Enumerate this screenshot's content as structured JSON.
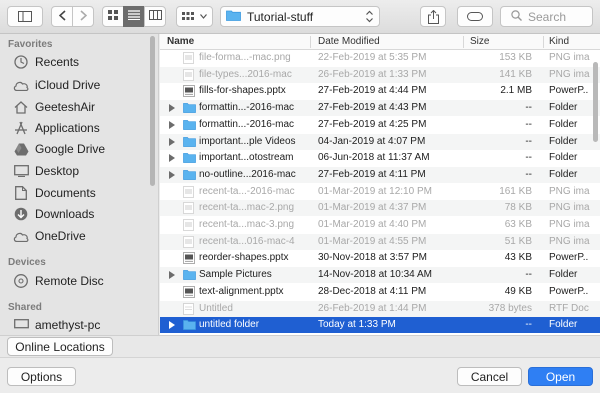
{
  "toolbar": {
    "location": "Tutorial-stuff",
    "search_placeholder": "Search"
  },
  "sidebar": {
    "favorites_header": "Favorites",
    "favorites": [
      {
        "label": "Recents",
        "icon": "clock-icon"
      },
      {
        "label": "iCloud Drive",
        "icon": "cloud-icon"
      },
      {
        "label": "GeeteshAir",
        "icon": "house-icon"
      },
      {
        "label": "Applications",
        "icon": "applications-icon"
      },
      {
        "label": "Google Drive",
        "icon": "google-drive-icon"
      },
      {
        "label": "Desktop",
        "icon": "desktop-icon"
      },
      {
        "label": "Documents",
        "icon": "document-icon"
      },
      {
        "label": "Downloads",
        "icon": "download-icon"
      },
      {
        "label": "OneDrive",
        "icon": "onedrive-cloud-icon"
      }
    ],
    "devices_header": "Devices",
    "devices": [
      {
        "label": "Remote Disc",
        "icon": "disc-icon"
      }
    ],
    "shared_header": "Shared",
    "shared": [
      {
        "label": "amethyst-pc",
        "icon": "network-computer-icon"
      }
    ]
  },
  "columns": {
    "name": "Name",
    "date": "Date Modified",
    "size": "Size",
    "kind": "Kind"
  },
  "files": [
    {
      "name": "file-forma...-mac.png",
      "date": "22-Feb-2019 at 5:35 PM",
      "size": "153 KB",
      "kind": "PNG ima",
      "type": "image",
      "dim": true,
      "folder": false
    },
    {
      "name": "file-types...2016-mac",
      "date": "26-Feb-2019 at 1:33 PM",
      "size": "141 KB",
      "kind": "PNG ima",
      "type": "image",
      "dim": true,
      "folder": false
    },
    {
      "name": "fills-for-shapes.pptx",
      "date": "27-Feb-2019 at 4:44 PM",
      "size": "2.1 MB",
      "kind": "PowerP..",
      "type": "pptx",
      "dim": false,
      "folder": false
    },
    {
      "name": "formattin...-2016-mac",
      "date": "27-Feb-2019 at 4:43 PM",
      "size": "--",
      "kind": "Folder",
      "type": "folder",
      "dim": false,
      "folder": true
    },
    {
      "name": "formattin...-2016-mac",
      "date": "27-Feb-2019 at 4:25 PM",
      "size": "--",
      "kind": "Folder",
      "type": "folder",
      "dim": false,
      "folder": true
    },
    {
      "name": "important...ple Videos",
      "date": "04-Jan-2019 at 4:07 PM",
      "size": "--",
      "kind": "Folder",
      "type": "folder",
      "dim": false,
      "folder": true
    },
    {
      "name": "important...otostream",
      "date": "06-Jun-2018 at 11:37 AM",
      "size": "--",
      "kind": "Folder",
      "type": "folder",
      "dim": false,
      "folder": true
    },
    {
      "name": "no-outline...2016-mac",
      "date": "27-Feb-2019 at 4:11 PM",
      "size": "--",
      "kind": "Folder",
      "type": "folder",
      "dim": false,
      "folder": true
    },
    {
      "name": "recent-ta...-2016-mac",
      "date": "01-Mar-2019 at 12:10 PM",
      "size": "161 KB",
      "kind": "PNG ima",
      "type": "image",
      "dim": true,
      "folder": false
    },
    {
      "name": "recent-ta...mac-2.png",
      "date": "01-Mar-2019 at 4:37 PM",
      "size": "78 KB",
      "kind": "PNG ima",
      "type": "image",
      "dim": true,
      "folder": false
    },
    {
      "name": "recent-ta...mac-3.png",
      "date": "01-Mar-2019 at 4:40 PM",
      "size": "63 KB",
      "kind": "PNG ima",
      "type": "image",
      "dim": true,
      "folder": false
    },
    {
      "name": "recent-ta...016-mac-4",
      "date": "01-Mar-2019 at 4:55 PM",
      "size": "51 KB",
      "kind": "PNG ima",
      "type": "image",
      "dim": true,
      "folder": false
    },
    {
      "name": "reorder-shapes.pptx",
      "date": "30-Nov-2018 at 3:57 PM",
      "size": "43 KB",
      "kind": "PowerP..",
      "type": "pptx",
      "dim": false,
      "folder": false
    },
    {
      "name": "Sample Pictures",
      "date": "14-Nov-2018 at 10:34 AM",
      "size": "--",
      "kind": "Folder",
      "type": "folder",
      "dim": false,
      "folder": true
    },
    {
      "name": "text-alignment.pptx",
      "date": "28-Dec-2018 at 4:11 PM",
      "size": "49 KB",
      "kind": "PowerP..",
      "type": "pptx",
      "dim": false,
      "folder": false
    },
    {
      "name": "Untitled",
      "date": "26-Feb-2019 at 1:44 PM",
      "size": "378 bytes",
      "kind": "RTF Doc",
      "type": "rtf",
      "dim": true,
      "folder": false
    },
    {
      "name": "untitled folder",
      "date": "Today at 1:33 PM",
      "size": "--",
      "kind": "Folder",
      "type": "folder",
      "dim": false,
      "folder": true,
      "selected": true
    }
  ],
  "buttons": {
    "online_locations": "Online Locations",
    "options": "Options",
    "cancel": "Cancel",
    "open": "Open"
  },
  "colors": {
    "accent": "#1f5fd2",
    "folder": "#5ab3ef",
    "primary_button": "#2f7ff3"
  }
}
